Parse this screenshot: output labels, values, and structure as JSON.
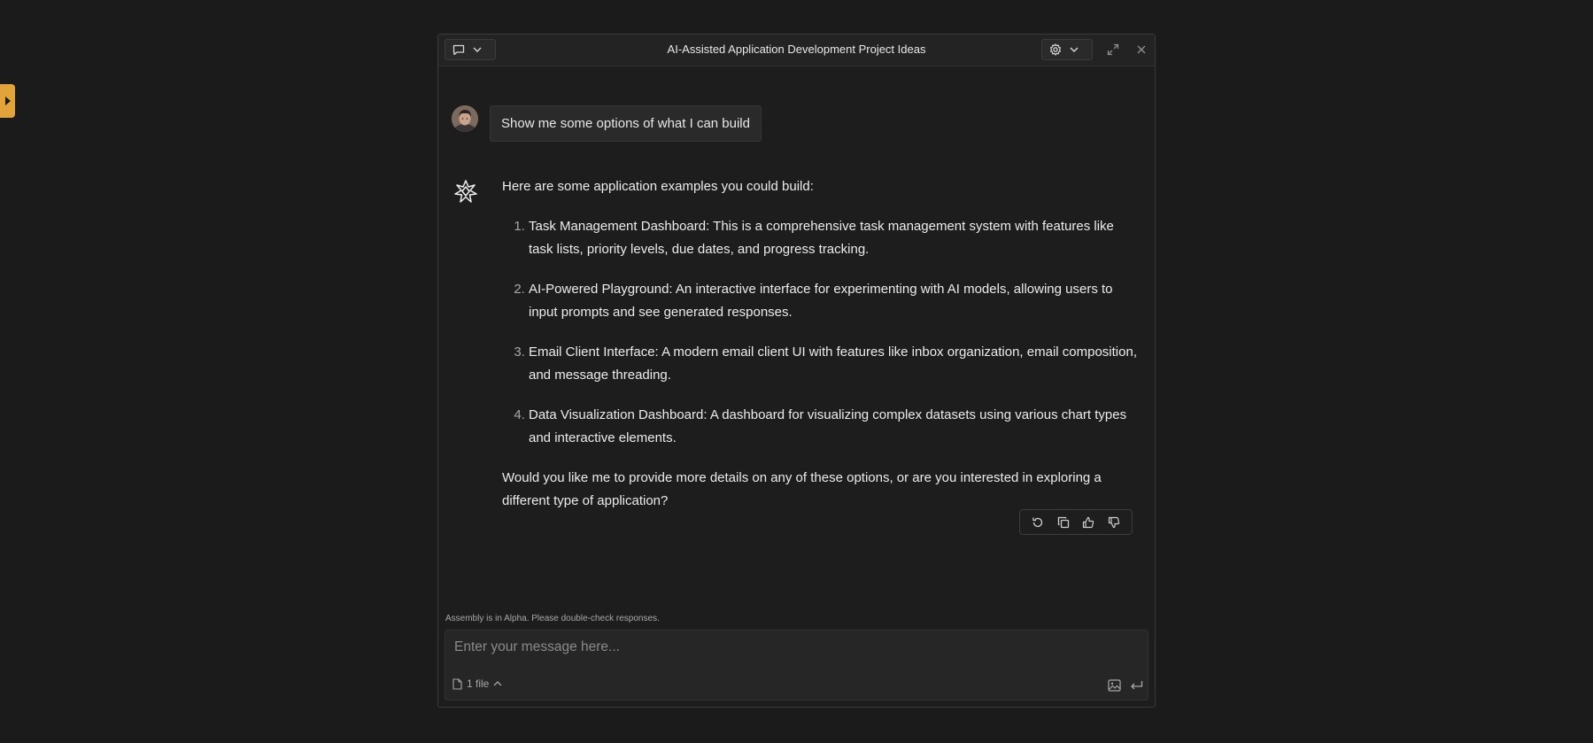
{
  "window": {
    "title": "AI-Assisted Application Development Project Ideas"
  },
  "icons": {
    "side_tab": "chevron-right-icon",
    "chat": "chat-bubble-icon",
    "settings": "gear-icon",
    "expand": "expand-icon",
    "close": "close-icon"
  },
  "colors": {
    "accent": "#e2a33a",
    "background": "#1b1b1b",
    "panel": "#1d1d1d"
  },
  "conversation": {
    "user_message": "Show me some options of what I can build",
    "assistant": {
      "intro": "Here are some application examples you could build:",
      "items": [
        "Task Management Dashboard: This is a comprehensive task management system with features like task lists, priority levels, due dates, and progress tracking.",
        "AI-Powered Playground: An interactive interface for experimenting with AI models, allowing users to input prompts and see generated responses.",
        "Email Client Interface: A modern email client UI with features like inbox organization, email composition, and message threading.",
        "Data Visualization Dashboard: A dashboard for visualizing complex datasets using various chart types and interactive elements."
      ],
      "outro": "Would you like me to provide more details on any of these options, or are you interested in exploring a different type of application?"
    }
  },
  "composer": {
    "alpha_note": "Assembly is in Alpha. Please double-check responses.",
    "placeholder": "Enter your message here...",
    "files_label": "1 file"
  }
}
